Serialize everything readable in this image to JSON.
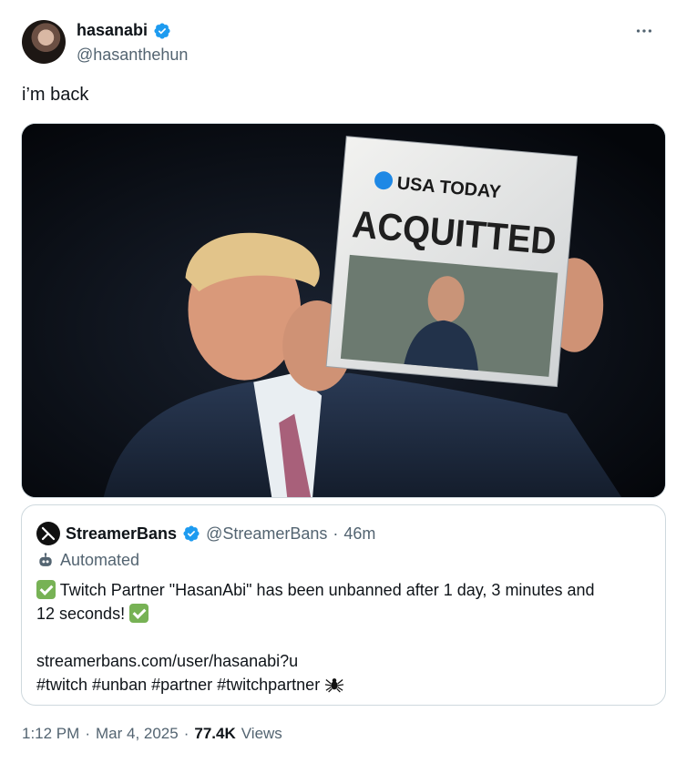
{
  "author": {
    "name": "hasanabi",
    "handle": "@hasanthehun",
    "verified_color": "#1d9bf0"
  },
  "tweet": {
    "text": "i’m back"
  },
  "media": {
    "newspaper_masthead": "USA TODAY",
    "headline": "ACQUITTED"
  },
  "quote": {
    "name": "StreamerBans",
    "handle": "@StreamerBans",
    "separator": "·",
    "time": "46m",
    "automated_label": "Automated",
    "line1": "Twitch Partner \"HasanAbi\" has been unbanned after 1 day, 3 minutes and",
    "line2": "12 seconds!",
    "link": "streamerbans.com/user/hasanabi?u",
    "hashtags": "#twitch #unban #partner #twitchpartner",
    "check_color": "#77b255"
  },
  "meta": {
    "time": "1:12 PM",
    "sep1": "·",
    "date": "Mar 4, 2025",
    "sep2": "·",
    "views_count": "77.4K",
    "views_label": "Views"
  },
  "icons": {
    "verified": "verified-badge-icon",
    "more": "more-options-icon",
    "automated": "robot-icon",
    "spider": "spider-icon"
  }
}
